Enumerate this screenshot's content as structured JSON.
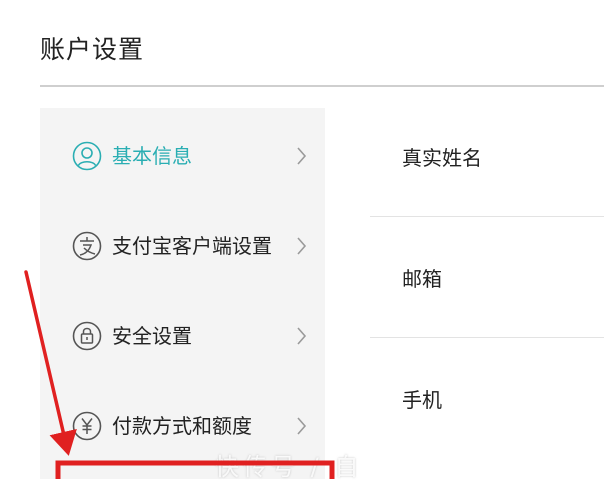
{
  "header": {
    "title": "账户设置"
  },
  "sidebar": {
    "items": [
      {
        "label": "基本信息",
        "icon": "user-circle-icon",
        "active": true
      },
      {
        "label": "支付宝客户端设置",
        "icon": "alipay-icon",
        "active": false
      },
      {
        "label": "安全设置",
        "icon": "lock-icon",
        "active": false
      },
      {
        "label": "付款方式和额度",
        "icon": "yuan-icon",
        "active": false
      }
    ]
  },
  "main": {
    "fields": [
      {
        "label": "真实姓名"
      },
      {
        "label": "邮箱"
      },
      {
        "label": "手机"
      }
    ]
  },
  "watermark": {
    "text": "快传号 / 自"
  },
  "colors": {
    "accent": "#2aaeb3",
    "annotation": "#e02020",
    "sidebar_bg": "#f4f4f4",
    "divider": "#cfcfcf"
  }
}
